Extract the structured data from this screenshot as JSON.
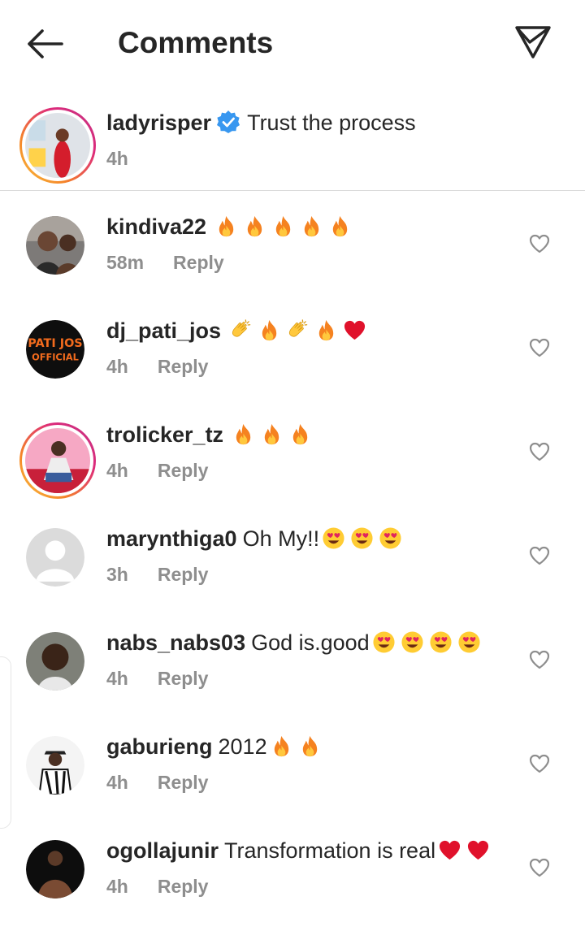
{
  "header": {
    "title": "Comments",
    "back_icon": "back-arrow-icon",
    "share_icon": "send-icon"
  },
  "caption": {
    "username": "ladyrisper",
    "verified": true,
    "text": "Trust the process",
    "time": "4h"
  },
  "comments": [
    {
      "username": "kindiva22",
      "text": "",
      "emojis": [
        "fire",
        "fire",
        "fire",
        "fire",
        "fire"
      ],
      "time": "58m",
      "reply_label": "Reply",
      "story_ring": false
    },
    {
      "username": "dj_pati_jos",
      "text": "",
      "emojis": [
        "clap",
        "fire",
        "clap",
        "fire",
        "red-heart"
      ],
      "time": "4h",
      "reply_label": "Reply",
      "story_ring": false
    },
    {
      "username": "trolicker_tz",
      "text": "",
      "emojis": [
        "fire",
        "fire",
        "fire"
      ],
      "time": "4h",
      "reply_label": "Reply",
      "story_ring": true
    },
    {
      "username": "marynthiga0",
      "text": "Oh My!!",
      "emojis": [
        "heart-eyes",
        "heart-eyes",
        "heart-eyes"
      ],
      "time": "3h",
      "reply_label": "Reply",
      "story_ring": false
    },
    {
      "username": "nabs_nabs03",
      "text": "God is.good",
      "emojis": [
        "heart-eyes",
        "heart-eyes",
        "heart-eyes",
        "heart-eyes"
      ],
      "time": "4h",
      "reply_label": "Reply",
      "story_ring": false
    },
    {
      "username": "gaburieng",
      "text": "2012",
      "emojis": [
        "fire",
        "fire"
      ],
      "time": "4h",
      "reply_label": "Reply",
      "story_ring": false
    },
    {
      "username": "ogollajunir",
      "text": "Transformation is real",
      "emojis": [
        "red-heart",
        "red-heart"
      ],
      "time": "4h",
      "reply_label": "Reply",
      "story_ring": false
    }
  ],
  "colors": {
    "text": "#262626",
    "muted": "#8e8e8e",
    "verified": "#3897f0",
    "divider": "#dbdbdb"
  }
}
